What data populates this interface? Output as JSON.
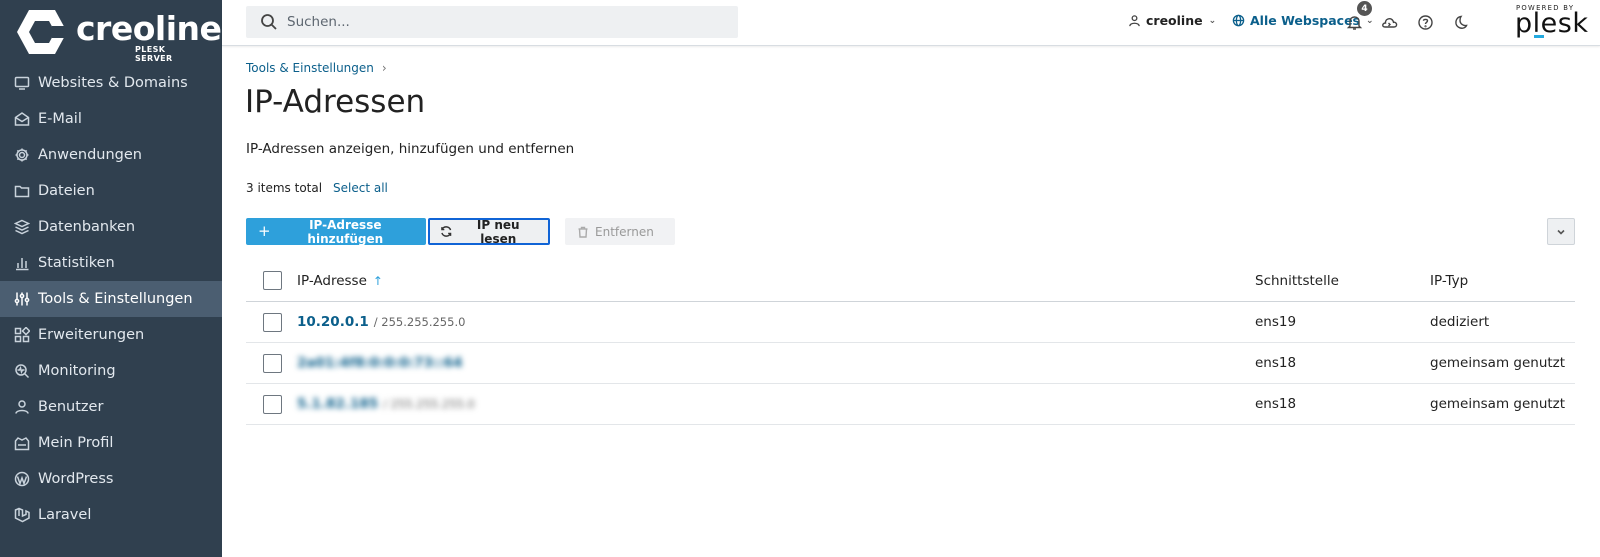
{
  "brand": {
    "name": "creoline",
    "sub": "PLESK SERVER",
    "powered_by": "POWERED BY",
    "plesk": "plesk"
  },
  "sidebar": {
    "items": [
      {
        "label": "Websites & Domains",
        "icon": "monitor-icon",
        "active": false
      },
      {
        "label": "E-Mail",
        "icon": "mail-icon",
        "active": false
      },
      {
        "label": "Anwendungen",
        "icon": "gear-icon",
        "active": false
      },
      {
        "label": "Dateien",
        "icon": "folder-icon",
        "active": false
      },
      {
        "label": "Datenbanken",
        "icon": "database-icon",
        "active": false
      },
      {
        "label": "Statistiken",
        "icon": "bar-chart-icon",
        "active": false
      },
      {
        "label": "Tools & Einstellungen",
        "icon": "sliders-icon",
        "active": true
      },
      {
        "label": "Erweiterungen",
        "icon": "puzzle-icon",
        "active": false
      },
      {
        "label": "Monitoring",
        "icon": "monitoring-icon",
        "active": false
      },
      {
        "label": "Benutzer",
        "icon": "user-icon",
        "active": false
      },
      {
        "label": "Mein Profil",
        "icon": "profile-icon",
        "active": false
      },
      {
        "label": "WordPress",
        "icon": "wordpress-icon",
        "active": false
      },
      {
        "label": "Laravel",
        "icon": "laravel-icon",
        "active": false
      }
    ]
  },
  "topbar": {
    "search_placeholder": "Suchen...",
    "user": "creoline",
    "webspaces": "Alle Webspaces",
    "notifications_count": "4"
  },
  "breadcrumb": {
    "items": [
      "Tools & Einstellungen"
    ]
  },
  "page": {
    "title": "IP-Adressen",
    "description": "IP-Adressen anzeigen, hinzufügen und entfernen",
    "items_total": "3 items total",
    "select_all": "Select all"
  },
  "toolbar": {
    "add_label": "IP-Adresse hinzufügen",
    "reread_label": "IP neu lesen",
    "remove_label": "Entfernen"
  },
  "table": {
    "columns": [
      "IP-Adresse",
      "Schnittstelle",
      "IP-Typ"
    ],
    "rows": [
      {
        "ip": "10.20.0.1",
        "mask": "/ 255.255.255.0",
        "interface": "ens19",
        "type": "dediziert",
        "blurred": false
      },
      {
        "ip": "2a01:4f8:0:0:0:73::64",
        "mask": "",
        "interface": "ens18",
        "type": "gemeinsam genutzt",
        "blurred": true
      },
      {
        "ip": "5.1.82.185",
        "mask": "/ 255.255.255.0",
        "interface": "ens18",
        "type": "gemeinsam genutzt",
        "blurred": true
      }
    ]
  }
}
